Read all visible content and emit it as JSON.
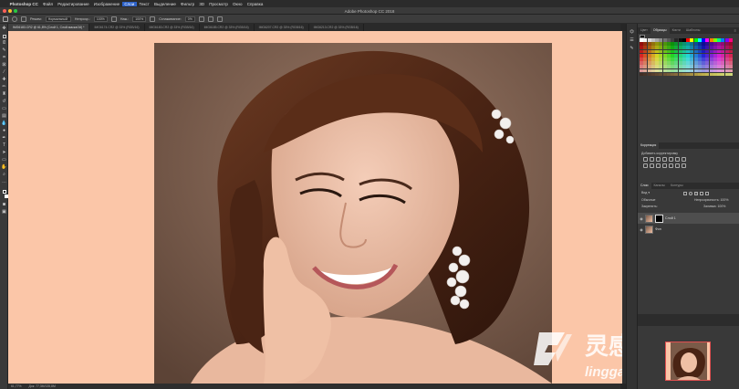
{
  "menubar": {
    "apple": "",
    "items": [
      "Photoshop CC",
      "Файл",
      "Редактирование",
      "Изображение",
      "Слои",
      "Текст",
      "Выделение",
      "Фильтр",
      "3D",
      "Просмотр",
      "Окно",
      "Справка"
    ],
    "active_index": 4
  },
  "titlebar": {
    "title": "Adobe Photoshop CC 2018"
  },
  "options": {
    "mode_label": "Режим:",
    "mode_value": "Нормальный",
    "opacity_label": "Непрозр.:",
    "opacity_value": "100%",
    "flow_label": "Наж.:",
    "flow_value": "100%",
    "smoothing_label": "Сглаживание:",
    "smoothing_value": "0%"
  },
  "tabs": [
    "IMG6183.CR2 @ 61,8% (Слой 1, Слой-маска/16) *",
    "IMG6174.CR2 @ 33% (RGB/16)",
    "IMG6183.CR2 @ 33% (RGB/16)",
    "IMG6185.CR2 @ 33% (RGB/16)",
    "IMG6207.CR2 @ 33% (RGB/16)",
    "IMG6213.CR2 @ 33% (RGB/16)"
  ],
  "status": {
    "zoom": "61,77%",
    "doc": "Док: 77,3M/135,8M"
  },
  "panels": {
    "swatch_tabs": [
      "Цвет",
      "Образцы",
      "Кисти",
      "Шаблоны"
    ],
    "adjust_title": "Коррекция",
    "adjust_hint": "Добавить корректировку",
    "layer_tabs": [
      "Слои",
      "Каналы",
      "Контуры"
    ],
    "kind_label": "Вид",
    "blend_mode": "Обычные",
    "opacity_label": "Непрозрачность:",
    "opacity_value": "100%",
    "lock_label": "Закрепить:",
    "fill_label": "Заливка:",
    "fill_value": "100%",
    "layers": [
      {
        "name": "Слой 1",
        "selected": true,
        "has_mask": true
      },
      {
        "name": "Фон",
        "selected": false,
        "has_mask": false
      }
    ]
  },
  "swatch_colors": [
    "#ffffff",
    "#f2f2f2",
    "#d9d9d9",
    "#bfbfbf",
    "#a6a6a6",
    "#8c8c8c",
    "#737373",
    "#595959",
    "#404040",
    "#262626",
    "#0d0d0d",
    "#000000",
    "#ff0000",
    "#ffff00",
    "#00ff00",
    "#00ffff",
    "#0000ff",
    "#ff00ff",
    "#ff7f00",
    "#7fff00",
    "#00ff7f",
    "#007fff",
    "#7f00ff",
    "#ff007f"
  ],
  "watermark": {
    "cn_text": "灵感中国",
    "url_text": "lingganchina.com"
  },
  "colors": {
    "canvas_bg": "#fbc6a8",
    "accent": "#2d62c8"
  }
}
